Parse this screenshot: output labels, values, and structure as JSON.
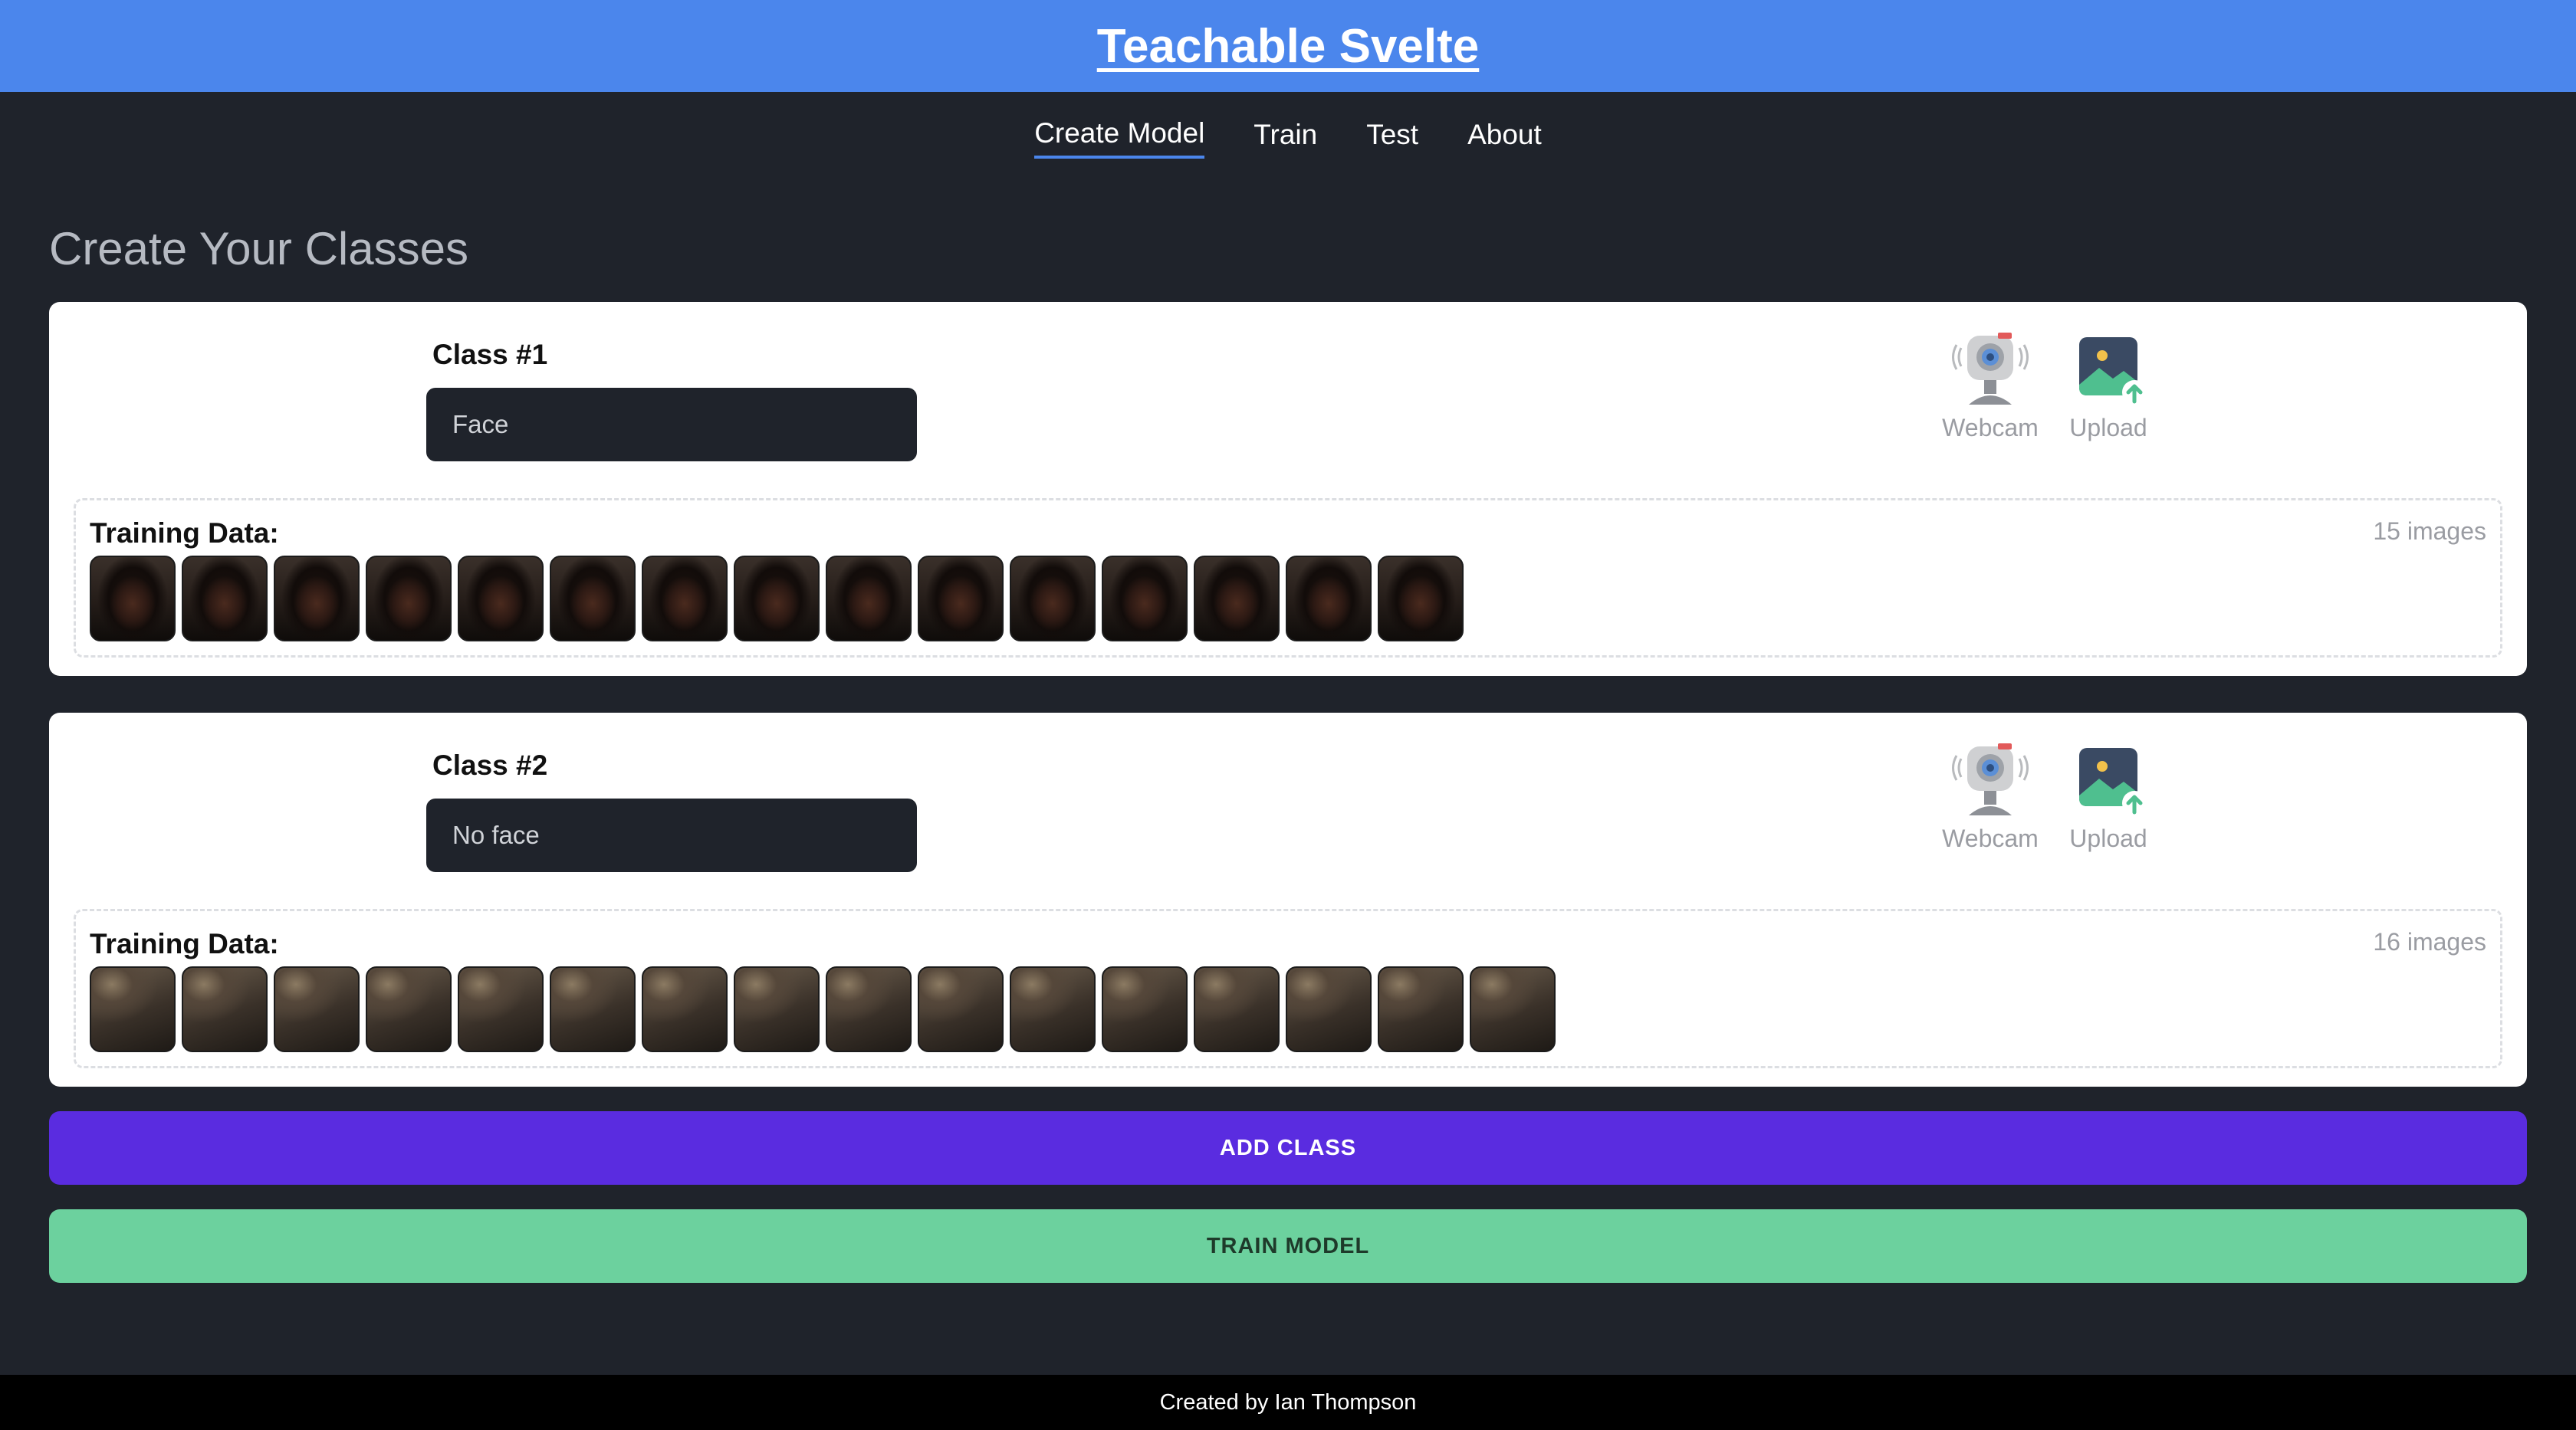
{
  "app": {
    "title": "Teachable Svelte"
  },
  "nav": {
    "items": [
      "Create Model",
      "Train",
      "Test",
      "About"
    ],
    "active": "Create Model"
  },
  "page": {
    "title": "Create Your Classes"
  },
  "tools": {
    "webcam_label": "Webcam",
    "upload_label": "Upload"
  },
  "classes": [
    {
      "label": "Class #1",
      "name": "Face",
      "training_label": "Training Data:",
      "image_count": "15 images",
      "images": 15
    },
    {
      "label": "Class #2",
      "name": "No face",
      "training_label": "Training Data:",
      "image_count": "16 images",
      "images": 16
    }
  ],
  "buttons": {
    "add_class": "ADD CLASS",
    "train_model": "TRAIN MODEL"
  },
  "footer": {
    "text": "Created by Ian Thompson"
  },
  "colors": {
    "header": "#4b86ec",
    "add_class": "#5a2ce0",
    "train_model": "#6cd19e",
    "background": "#1f232b"
  }
}
